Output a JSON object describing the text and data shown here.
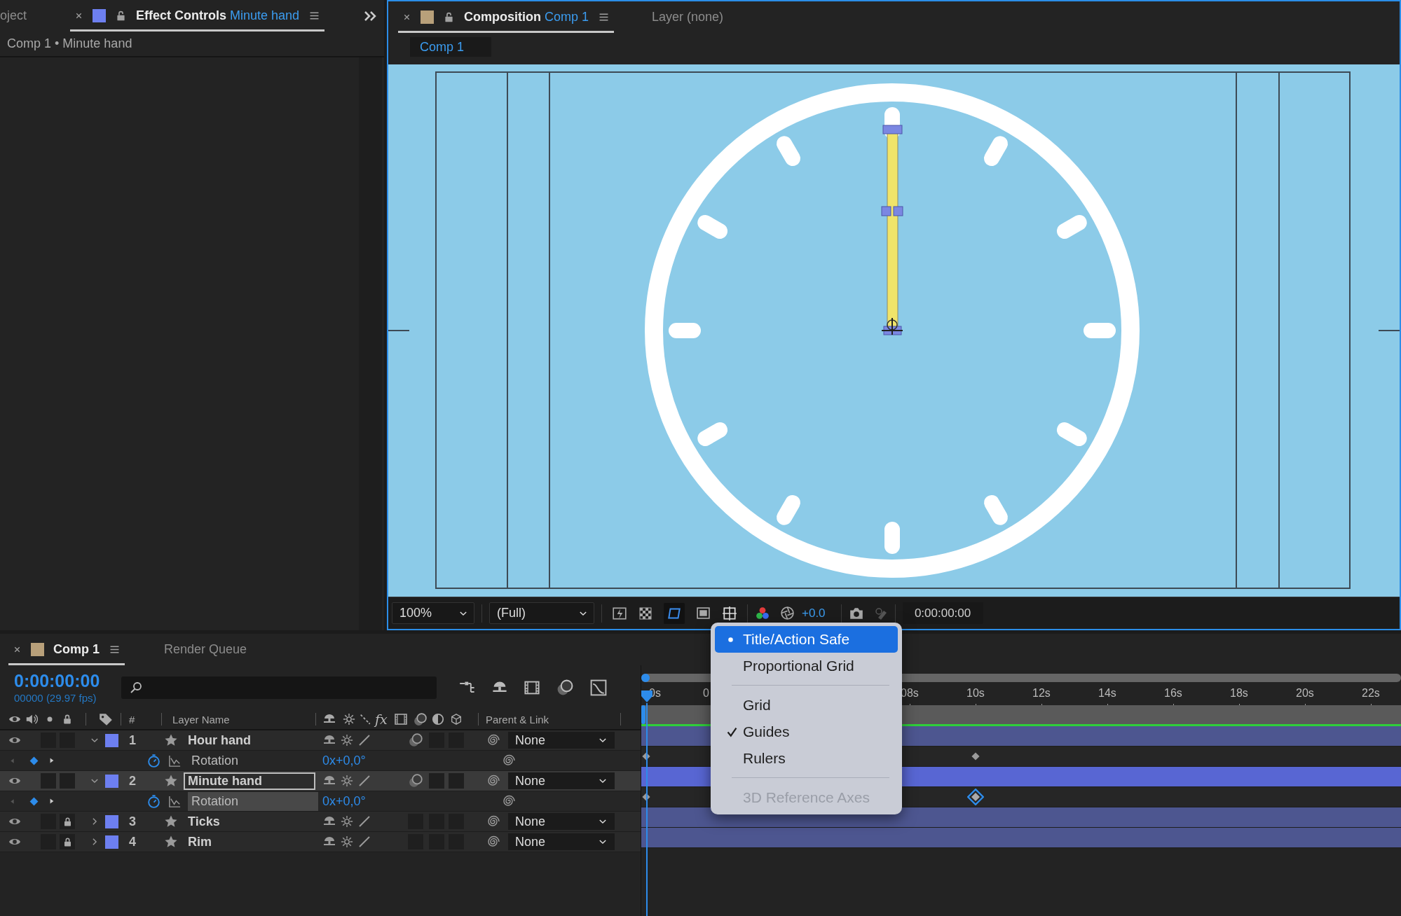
{
  "effect_panel": {
    "tabs": [
      {
        "label": "oject",
        "selected": false
      },
      {
        "label": "Effect Controls",
        "detail": "Minute hand",
        "selected": true
      }
    ],
    "breadcrumb": "Comp 1 • Minute hand"
  },
  "composition_panel": {
    "tabs": [
      {
        "label": "Composition",
        "detail": "Comp 1",
        "selected": true
      },
      {
        "label": "Layer (none)",
        "selected": false
      }
    ],
    "viewer_tab": "Comp 1",
    "toolbar": {
      "magnification": "100%",
      "resolution": "(Full)",
      "exposure": "+0.0",
      "timecode": "0:00:00:00"
    }
  },
  "timeline": {
    "tabs": [
      {
        "label": "Comp 1",
        "selected": true
      },
      {
        "label": "Render Queue",
        "selected": false
      }
    ],
    "timecode": "0:00:00:00",
    "frame_info": "00000 (29.97 fps)",
    "columns": {
      "number": "#",
      "layer_name": "Layer Name",
      "effects": "fx",
      "parent": "Parent & Link"
    },
    "ruler": [
      "0s",
      "0",
      "08s",
      "10s",
      "12s",
      "14s",
      "16s",
      "18s",
      "20s",
      "22s"
    ],
    "layers": [
      {
        "number": "1",
        "name": "Hour hand",
        "expanded": true,
        "solo": false,
        "locked": false,
        "selected": false,
        "motion_blur": true,
        "adjustment": false,
        "three_d": false,
        "parent": "None",
        "property": {
          "name": "Rotation",
          "value": "0x+0,0°",
          "selected": false,
          "keyframes": [
            {
              "selected": false
            },
            {
              "selected": false
            }
          ]
        }
      },
      {
        "number": "2",
        "name": "Minute hand",
        "expanded": true,
        "solo": false,
        "locked": false,
        "selected": true,
        "motion_blur": true,
        "adjustment": false,
        "three_d": false,
        "parent": "None",
        "property": {
          "name": "Rotation",
          "value": "0x+0,0°",
          "selected": true,
          "keyframes": [
            {
              "selected": false
            },
            {
              "selected": true
            }
          ]
        }
      },
      {
        "number": "3",
        "name": "Ticks",
        "expanded": false,
        "solo": false,
        "locked": true,
        "selected": false,
        "motion_blur": false,
        "adjustment": false,
        "three_d": false,
        "parent": "None"
      },
      {
        "number": "4",
        "name": "Rim",
        "expanded": false,
        "solo": false,
        "locked": true,
        "selected": false,
        "motion_blur": false,
        "adjustment": false,
        "three_d": false,
        "parent": "None"
      }
    ]
  },
  "view_options_menu": {
    "items": [
      {
        "kind": "item",
        "label": "Title/Action Safe",
        "bulleted": true,
        "checked": false,
        "highlighted": true,
        "disabled": false
      },
      {
        "kind": "item",
        "label": "Proportional Grid",
        "bulleted": false,
        "checked": false,
        "highlighted": false,
        "disabled": false
      },
      {
        "kind": "separator"
      },
      {
        "kind": "item",
        "label": "Grid",
        "bulleted": false,
        "checked": false,
        "highlighted": false,
        "disabled": false
      },
      {
        "kind": "item",
        "label": "Guides",
        "bulleted": false,
        "checked": true,
        "highlighted": false,
        "disabled": false
      },
      {
        "kind": "item",
        "label": "Rulers",
        "bulleted": false,
        "checked": false,
        "highlighted": false,
        "disabled": false
      },
      {
        "kind": "separator"
      },
      {
        "kind": "item",
        "label": "3D Reference Axes",
        "bulleted": false,
        "checked": false,
        "highlighted": false,
        "disabled": true
      }
    ]
  }
}
